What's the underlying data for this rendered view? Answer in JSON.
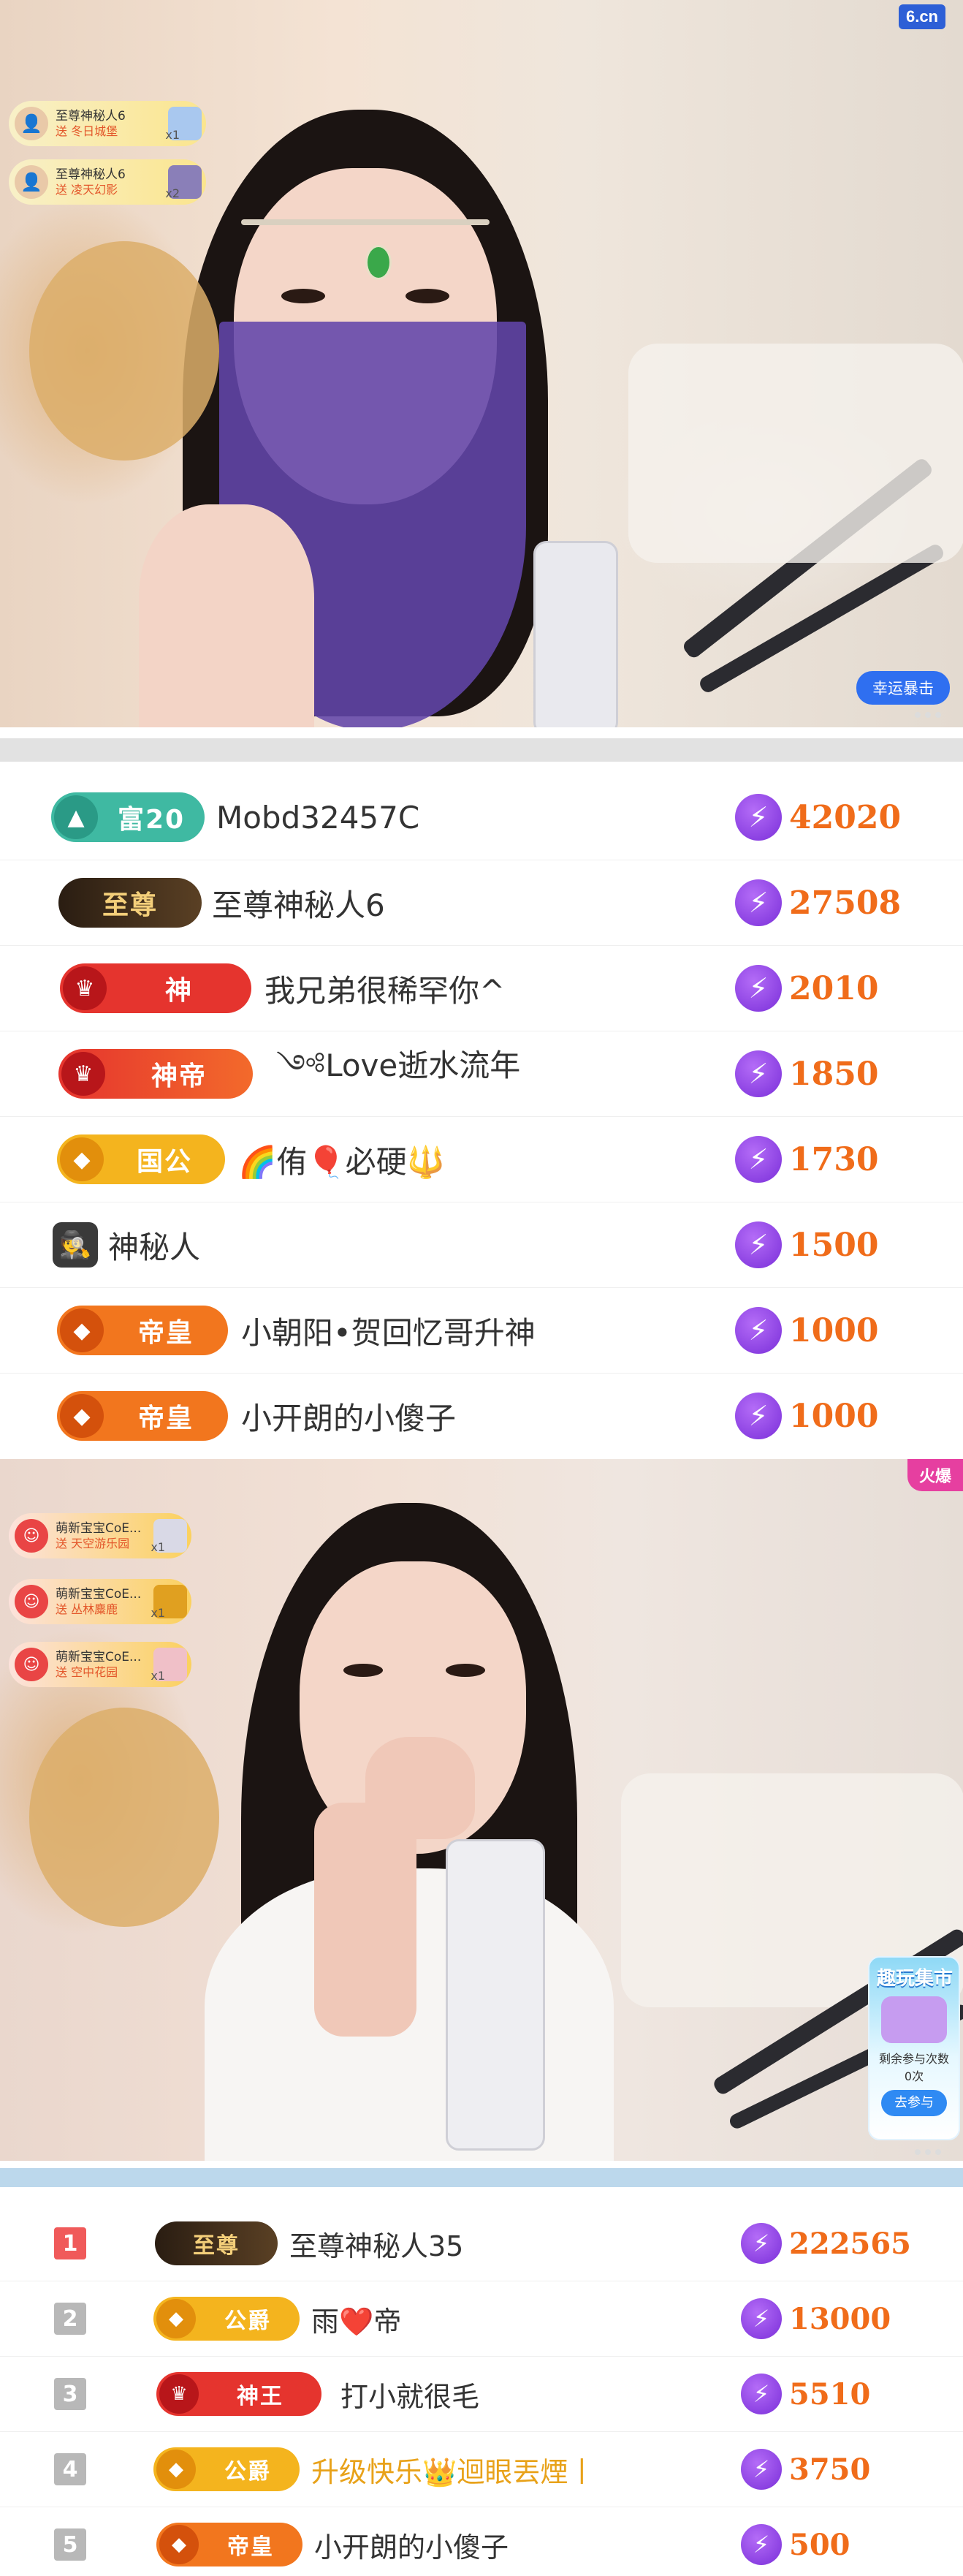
{
  "stream1": {
    "logo": "6.cn",
    "lucky_button": "幸运暴击",
    "gifts": [
      {
        "name": "至尊神秘人6",
        "gift": "送 冬日城堡",
        "count": "x1"
      },
      {
        "name": "至尊神秘人6",
        "gift": "送 凌天幻影",
        "count": "x2"
      }
    ]
  },
  "ranking1": [
    {
      "badge": "富20",
      "name": "Mobd32457C",
      "score": "42020",
      "badge_color": "#3fb9a2"
    },
    {
      "badge": "至尊",
      "name": "至尊神秘人6",
      "score": "27508",
      "badge_color": "#3a2a1a"
    },
    {
      "badge": "神",
      "name": "我兄弟很稀罕你^",
      "score": "2010",
      "badge_color": "#e5342e"
    },
    {
      "badge": "神帝",
      "name": "༺Love逝水流年",
      "score": "1850",
      "badge_color": "#e5342e"
    },
    {
      "badge": "国公",
      "name": "🌈侑🎈必硬🔱",
      "score": "1730",
      "badge_color": "#f4b41e"
    },
    {
      "badge": "",
      "name": "神秘人",
      "score": "1500",
      "badge_color": ""
    },
    {
      "badge": "帝皇",
      "name": "小朝阳•贺回忆哥升神",
      "score": "1000",
      "badge_color": "#f2761e"
    },
    {
      "badge": "帝皇",
      "name": "小开朗的小傻子",
      "score": "1000",
      "badge_color": "#f2761e"
    }
  ],
  "stream2": {
    "hot_badge": "火爆",
    "gifts": [
      {
        "name": "萌新宝宝CoE...",
        "gift": "送 天空游乐园",
        "count": "x1"
      },
      {
        "name": "萌新宝宝CoE...",
        "gift": "送 丛林麋鹿",
        "count": "x1"
      },
      {
        "name": "萌新宝宝CoE...",
        "gift": "送 空中花园",
        "count": "x1"
      }
    ],
    "promo": {
      "title": "趣玩集市",
      "subtitle": "剩余参与次数",
      "count": "0次",
      "button": "去参与"
    }
  },
  "ranking2": [
    {
      "rank": "1",
      "badge": "至尊",
      "name": "至尊神秘人35",
      "score": "222565",
      "badge_color": "#3a2a1a",
      "rank_color": "#f05a5a"
    },
    {
      "rank": "2",
      "badge": "公爵",
      "name": "雨❤️帝",
      "score": "13000",
      "badge_color": "#f4b41e",
      "rank_color": "#b8b8b8"
    },
    {
      "rank": "3",
      "badge": "神王",
      "name": "打小就很毛",
      "score": "5510",
      "badge_color": "#e5342e",
      "rank_color": "#b8b8b8"
    },
    {
      "rank": "4",
      "badge": "公爵",
      "name": "升级快乐👑迴眼丟煙丨",
      "score": "3750",
      "badge_color": "#f4b41e",
      "rank_color": "#b8b8b8"
    },
    {
      "rank": "5",
      "badge": "帝皇",
      "name": "小开朗的小傻子",
      "score": "500",
      "badge_color": "#f2761e",
      "rank_color": "#b8b8b8"
    }
  ]
}
